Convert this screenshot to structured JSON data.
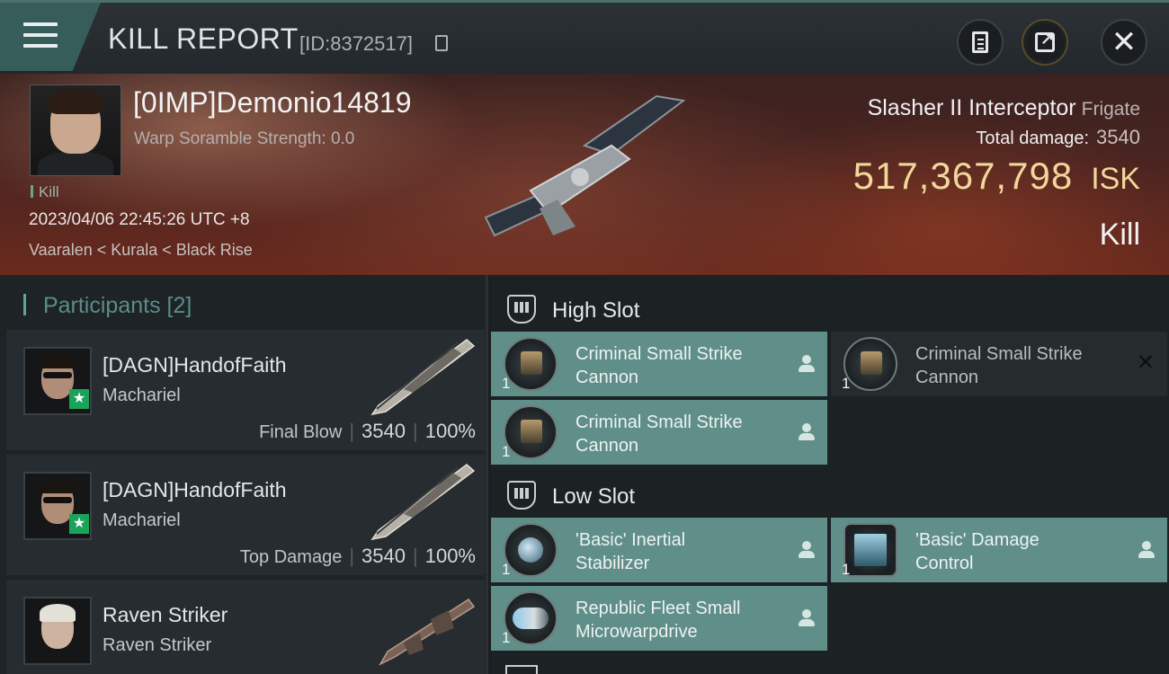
{
  "header": {
    "title": "KILL REPORT",
    "report_id": "[ID:8372517]"
  },
  "victim": {
    "name": "[0IMP]Demonio14819",
    "warp_scramble": "Warp Soramble Strength: 0.0",
    "kill_tag": "Kill",
    "timestamp": "2023/04/06 22:45:26 UTC +8",
    "location": "Vaaralen < Kurala < Black Rise",
    "ship_name": "Slasher II Interceptor",
    "ship_class": "Frigate",
    "total_damage_label": "Total damage:",
    "total_damage": "3540",
    "isk_value": "517,367,798",
    "isk_unit": "ISK",
    "result": "Kill"
  },
  "participants": {
    "header": "Participants",
    "count": "[2]",
    "items": [
      {
        "name": "[DAGN]HandofFaith",
        "ship": "Machariel",
        "role": "Final Blow",
        "damage": "3540",
        "percent": "100%"
      },
      {
        "name": "[DAGN]HandofFaith",
        "ship": "Machariel",
        "role": "Top Damage",
        "damage": "3540",
        "percent": "100%"
      },
      {
        "name": "Raven Striker",
        "ship": "Raven Striker"
      }
    ]
  },
  "fitting": {
    "high_slot": {
      "title": "High Slot",
      "modules": [
        {
          "name_line1": "Criminal Small Strike",
          "name_line2": "Cannon",
          "qty": "1"
        },
        {
          "name_line1": "Criminal Small Strike",
          "name_line2": "Cannon",
          "qty": "1"
        },
        {
          "name_line1": "Criminal Small Strike",
          "name_line2": "Cannon",
          "qty": "1"
        }
      ]
    },
    "low_slot": {
      "title": "Low Slot",
      "modules": [
        {
          "name_line1": "'Basic' Inertial",
          "name_line2": "Stabilizer",
          "qty": "1"
        },
        {
          "name_line1": "'Basic' Damage",
          "name_line2": "Control",
          "qty": "1"
        },
        {
          "name_line1": "Republic Fleet Small",
          "name_line2": "Microwarpdrive",
          "qty": "1"
        }
      ]
    }
  },
  "icons": {
    "menu": "hamburger-menu-icon",
    "copy": "copy-icon",
    "clipboard": "clipboard-icon",
    "share": "share-icon",
    "close": "close-icon",
    "slot": "slot-icon",
    "pilot": "person-icon"
  },
  "colors": {
    "accent_teal": "#5f8f88",
    "isk_gold": "#f1d79b",
    "final_blow_star": "#19a45a"
  }
}
